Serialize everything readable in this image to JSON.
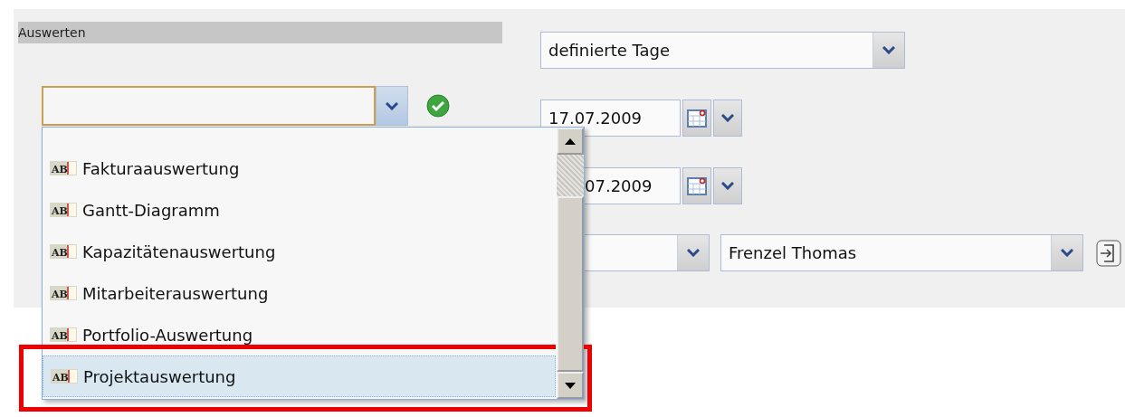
{
  "section": {
    "title": "Auswerten"
  },
  "report_combo": {
    "expanded": true
  },
  "report_list": {
    "items": [
      {
        "icon_text": "AB",
        "label": "Fakturaauswertung",
        "selected": false
      },
      {
        "icon_text": "AB",
        "label": "Gantt-Diagramm",
        "selected": false
      },
      {
        "icon_text": "AB",
        "label": "Kapazitätenauswertung",
        "selected": false
      },
      {
        "icon_text": "AB",
        "label": "Mitarbeiterauswertung",
        "selected": false
      },
      {
        "icon_text": "AB",
        "label": "Portfolio-Auswertung",
        "selected": false
      },
      {
        "icon_text": "AB",
        "label": "Projektauswertung",
        "selected": true
      }
    ]
  },
  "period_dropdown": {
    "value": "definierte Tage"
  },
  "date_from": {
    "value": "17.07.2009"
  },
  "date_to": {
    "value": "07.2009"
  },
  "employee_dropdown": {
    "value": "Frenzel Thomas"
  }
}
